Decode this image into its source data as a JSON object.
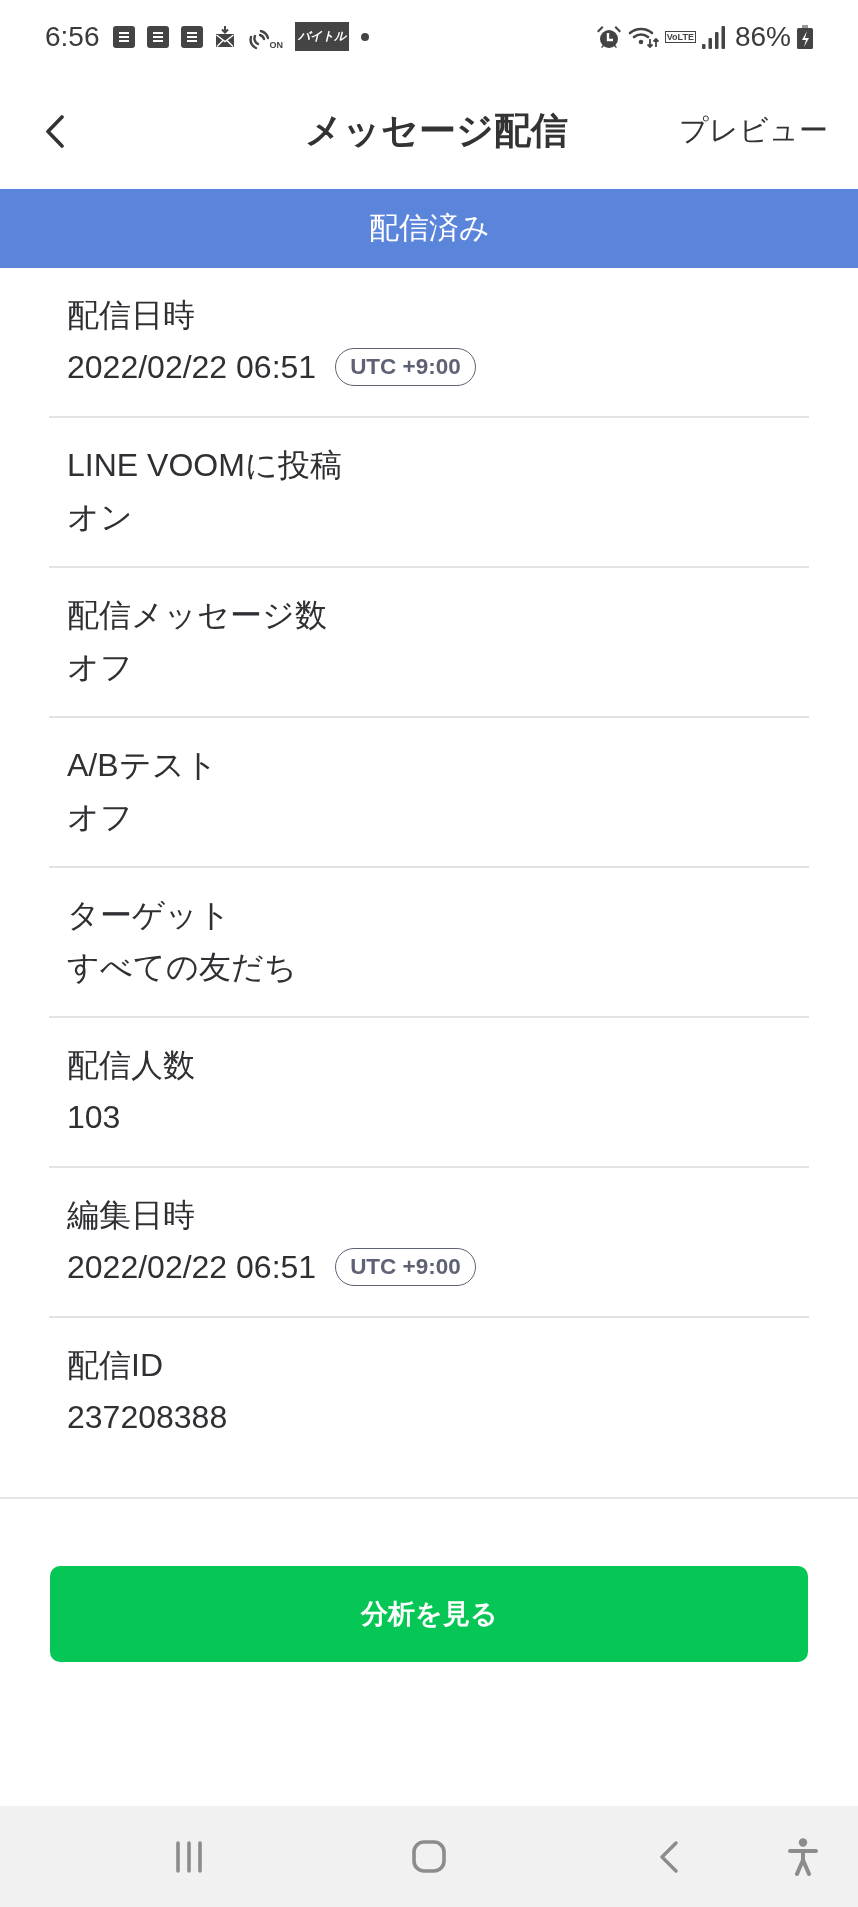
{
  "status_bar": {
    "time": "6:56",
    "app_badge": "バイトル",
    "nfc_label": "ON",
    "network_label": "VoLTE",
    "battery": "86%"
  },
  "header": {
    "title": "メッセージ配信",
    "action": "プレビュー"
  },
  "banner": {
    "label": "配信済み"
  },
  "details": [
    {
      "label": "配信日時",
      "value": "2022/02/22 06:51",
      "timezone": "UTC +9:00"
    },
    {
      "label": "LINE VOOMに投稿",
      "value": "オン"
    },
    {
      "label": "配信メッセージ数",
      "value": "オフ"
    },
    {
      "label": "A/Bテスト",
      "value": "オフ"
    },
    {
      "label": "ターゲット",
      "value": "すべての友だち"
    },
    {
      "label": "配信人数",
      "value": "103"
    },
    {
      "label": "編集日時",
      "value": "2022/02/22 06:51",
      "timezone": "UTC +9:00"
    },
    {
      "label": "配信ID",
      "value": "237208388"
    }
  ],
  "primary_button": {
    "label": "分析を見る"
  }
}
